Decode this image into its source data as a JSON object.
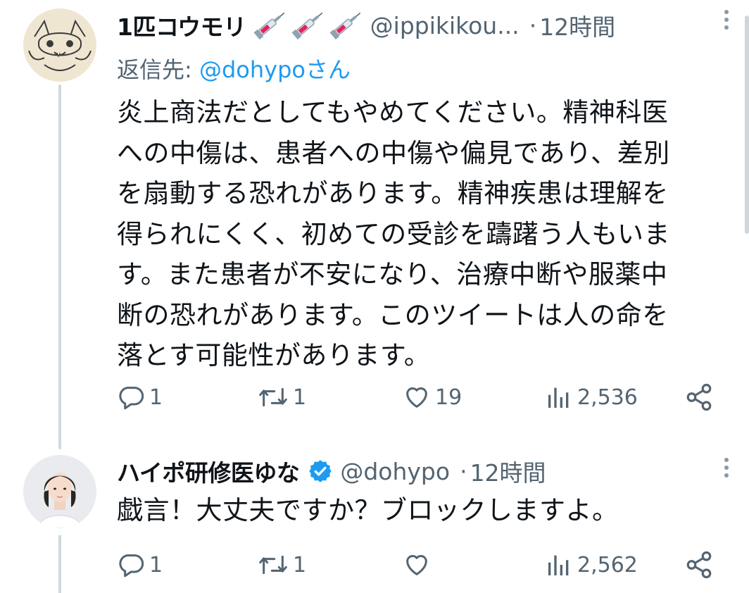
{
  "tweets": [
    {
      "display_name": "1匹コウモリ",
      "handle": "@ippikikou...",
      "dot": "·",
      "time": "12時間",
      "reply_prefix": "返信先: ",
      "reply_mention": "@dohypoさん",
      "avatar_icon": "bat-drawing-avatar",
      "name_emoji": "syringe",
      "body": "炎上商法だとしてもやめてください。精神科医\nへの中傷は、患者への中傷や偏見であり、差別\nを扇動する恐れがあります。精神疾患は理解を\n得られにくく、初めての受診を躊躇う人もいま\nす。また患者が不安になり、治療中断や服薬中\n断の恐れがあります。このツイートは人の命を\n落とす可能性があります。",
      "reply_count": "1",
      "retweet_count": "1",
      "like_count": "19",
      "view_count": "2,536"
    },
    {
      "display_name": "ハイポ研修医ゆな",
      "handle": "@dohypo",
      "dot": "·",
      "time": "12時間",
      "verified": true,
      "avatar_icon": "profile-photo-avatar",
      "body": "戯言！大丈夫ですか？ブロックしますよ。",
      "reply_count": "1",
      "retweet_count": "1",
      "like_count": "",
      "view_count": "2,562"
    }
  ],
  "colors": {
    "text_primary": "#0f1419",
    "text_secondary": "#536471",
    "link": "#1d9bf0",
    "verified": "#1d9bf0",
    "thread_line": "#cfd9de"
  }
}
